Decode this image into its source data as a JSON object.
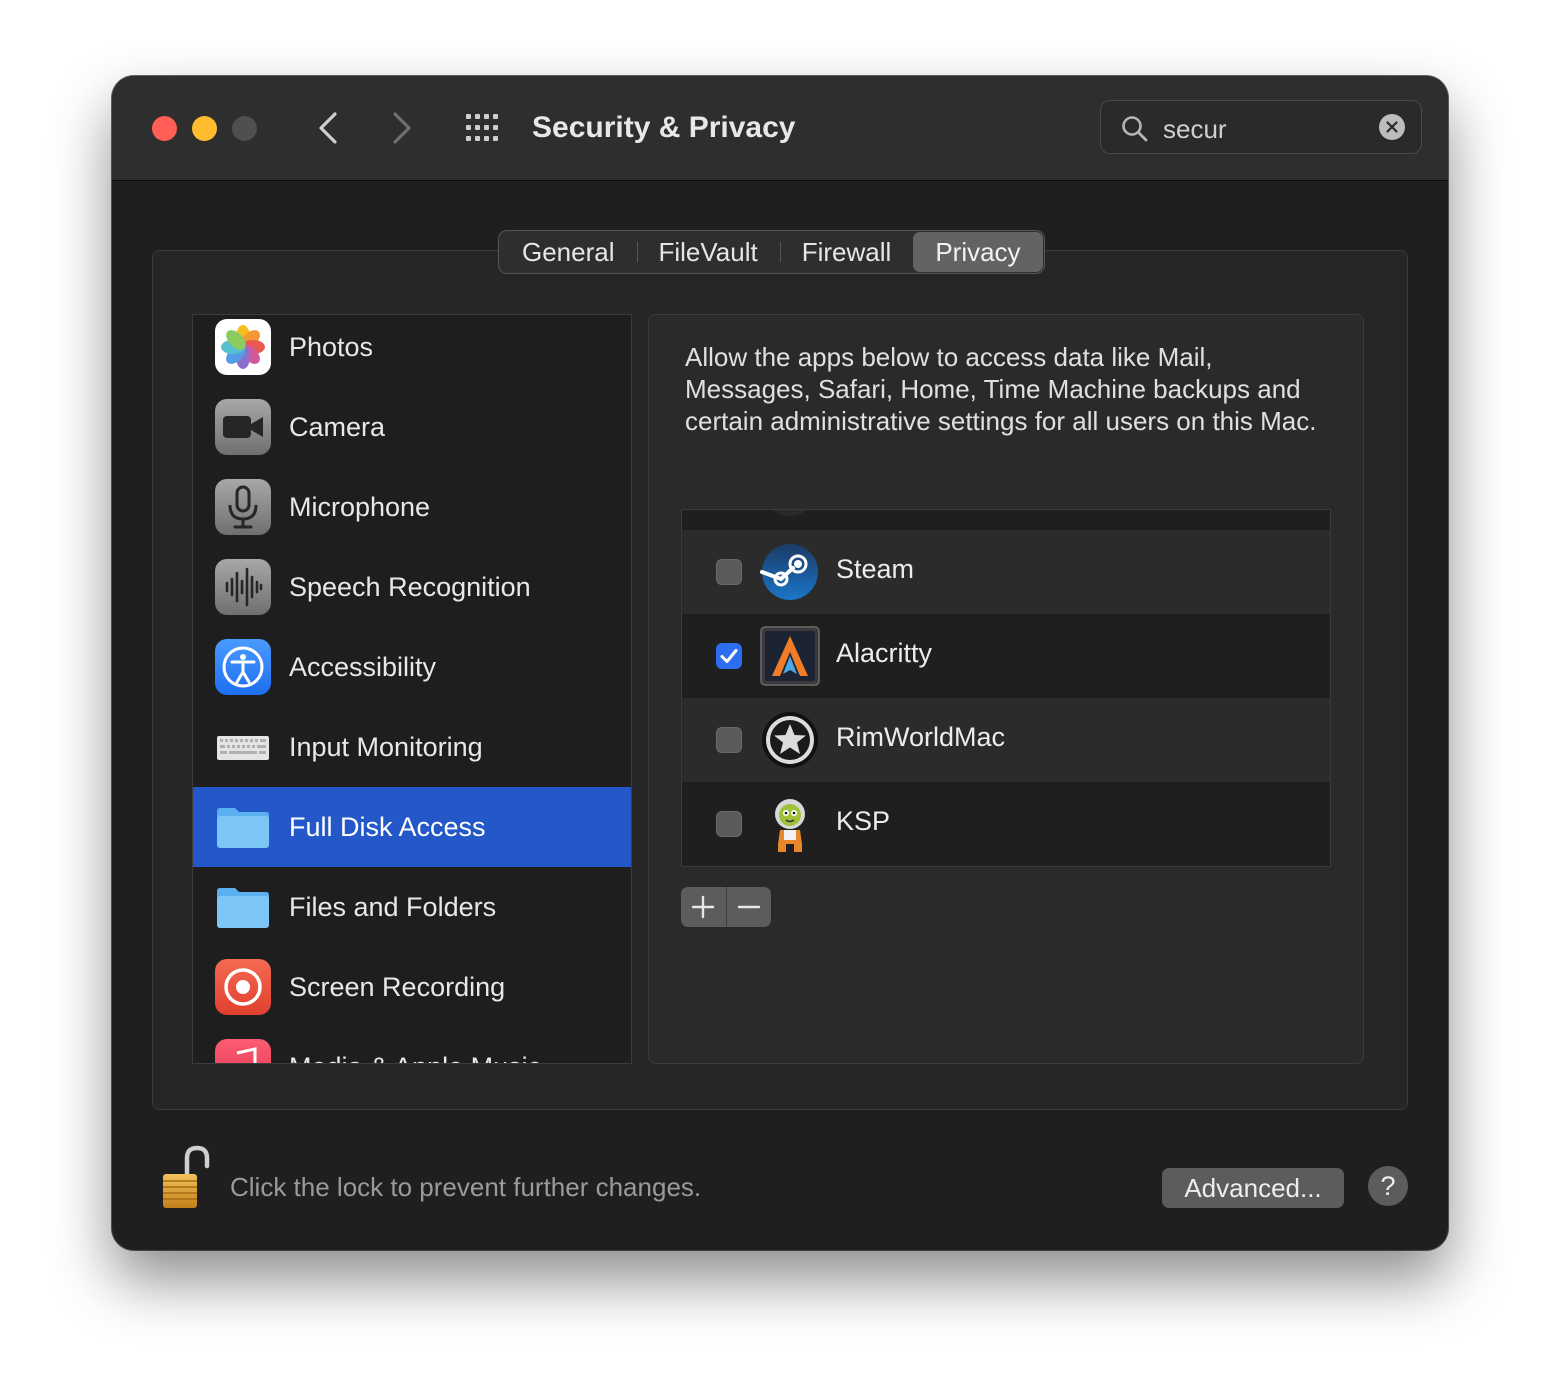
{
  "window": {
    "title": "Security & Privacy"
  },
  "search": {
    "value": "secur"
  },
  "tabs": [
    {
      "label": "General",
      "active": false
    },
    {
      "label": "FileVault",
      "active": false
    },
    {
      "label": "Firewall",
      "active": false
    },
    {
      "label": "Privacy",
      "active": true
    }
  ],
  "sidebar": {
    "items": [
      {
        "label": "Photos",
        "icon": "photos-icon"
      },
      {
        "label": "Camera",
        "icon": "camera-icon"
      },
      {
        "label": "Microphone",
        "icon": "microphone-icon"
      },
      {
        "label": "Speech Recognition",
        "icon": "speech-recognition-icon"
      },
      {
        "label": "Accessibility",
        "icon": "accessibility-icon"
      },
      {
        "label": "Input Monitoring",
        "icon": "keyboard-icon"
      },
      {
        "label": "Full Disk Access",
        "icon": "folder-icon",
        "selected": true
      },
      {
        "label": "Files and Folders",
        "icon": "folder-icon"
      },
      {
        "label": "Screen Recording",
        "icon": "screen-recording-icon"
      },
      {
        "label": "Media & Apple Music",
        "icon": "music-icon"
      }
    ]
  },
  "main": {
    "description": "Allow the apps below to access data like Mail, Messages, Safari, Home, Time Machine backups and certain administrative settings for all users on this Mac.",
    "apps": [
      {
        "name": "Steam",
        "checked": false,
        "icon": "steam-icon"
      },
      {
        "name": "Alacritty",
        "checked": true,
        "icon": "alacritty-icon"
      },
      {
        "name": "RimWorldMac",
        "checked": false,
        "icon": "rimworld-icon"
      },
      {
        "name": "KSP",
        "checked": false,
        "icon": "ksp-icon"
      }
    ]
  },
  "footer": {
    "lock_text": "Click the lock to prevent further changes.",
    "advanced_label": "Advanced...",
    "help_label": "?"
  },
  "colors": {
    "selection": "#2458c9",
    "checkbox_on": "#2d6ef0",
    "close": "#ff5f57",
    "minimize": "#febc2e"
  }
}
